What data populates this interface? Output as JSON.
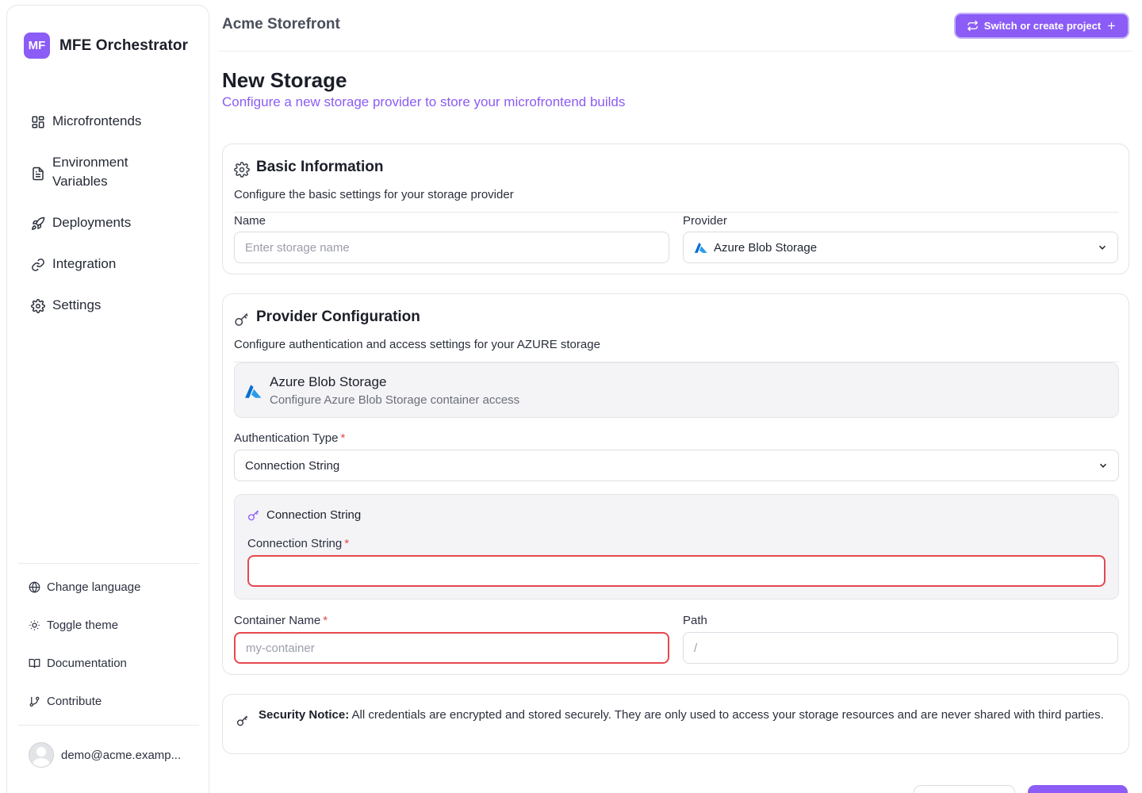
{
  "app": {
    "logo_text": "MF",
    "name": "MFE Orchestrator"
  },
  "sidebar": {
    "items": [
      {
        "label": "Microfrontends",
        "icon": "grid-icon"
      },
      {
        "label": "Environment Variables",
        "icon": "file-text-icon"
      },
      {
        "label": "Deployments",
        "icon": "rocket-icon"
      },
      {
        "label": "Integration",
        "icon": "link-icon"
      },
      {
        "label": "Settings",
        "icon": "gear-icon"
      }
    ],
    "utilities": [
      {
        "label": "Change language",
        "icon": "globe-icon"
      },
      {
        "label": "Toggle theme",
        "icon": "sun-icon"
      },
      {
        "label": "Documentation",
        "icon": "book-icon"
      },
      {
        "label": "Contribute",
        "icon": "git-branch-icon"
      }
    ],
    "user_email": "demo@acme.examp..."
  },
  "header": {
    "project": "Acme Storefront",
    "switch_label": "Switch or create project"
  },
  "page": {
    "title": "New Storage",
    "subtitle": "Configure a new storage provider to store your microfrontend builds"
  },
  "basic": {
    "title": "Basic Information",
    "description": "Configure the basic settings for your storage provider",
    "name_label": "Name",
    "name_placeholder": "Enter storage name",
    "provider_label": "Provider",
    "provider_value": "Azure Blob Storage"
  },
  "provider_config": {
    "title": "Provider Configuration",
    "description": "Configure authentication and access settings for your AZURE storage",
    "panel_title": "Azure Blob Storage",
    "panel_subtitle": "Configure Azure Blob Storage container access",
    "auth_label": "Authentication Type",
    "auth_value": "Connection String",
    "conn_section_title": "Connection String",
    "conn_label": "Connection String",
    "conn_value": "",
    "container_label": "Container Name",
    "container_placeholder": "my-container",
    "path_label": "Path",
    "path_placeholder": "/",
    "required_mark": "*"
  },
  "notice": {
    "bold": "Security Notice:",
    "text": " All credentials are encrypted and stored securely. They are only used to access your storage resources and are never shared with third parties."
  },
  "colors": {
    "accent": "#8b5cf6",
    "error": "#e5484d",
    "azure": "#0078d4"
  }
}
